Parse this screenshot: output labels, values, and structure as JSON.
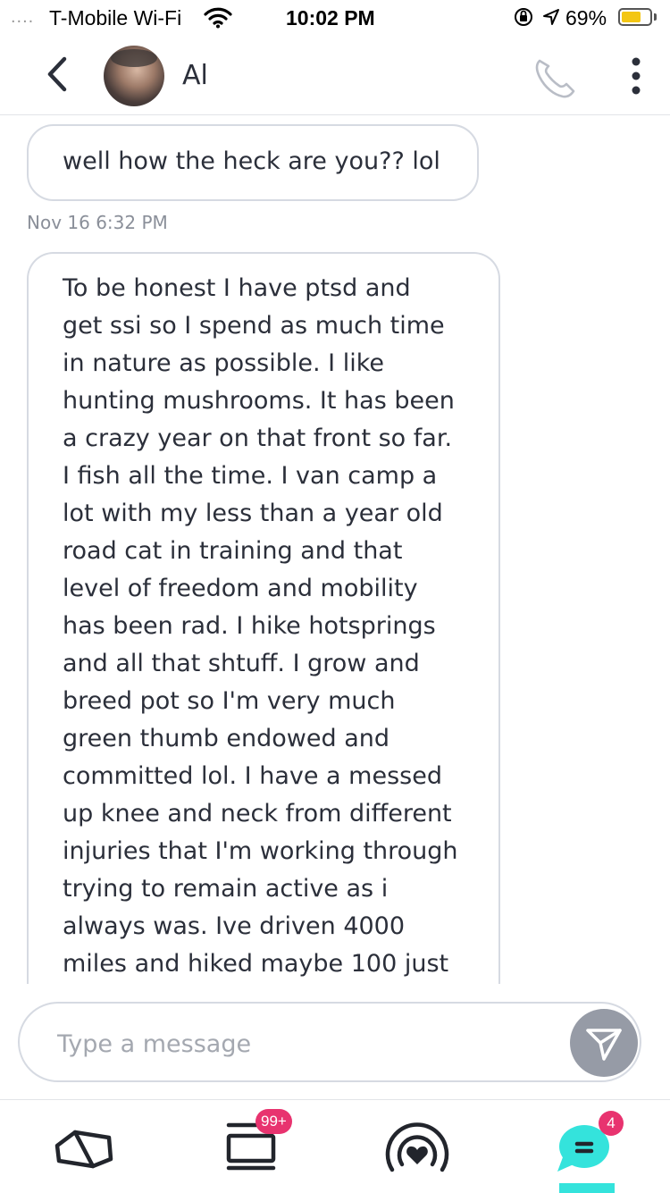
{
  "status_bar": {
    "signal": "....",
    "carrier": "T-Mobile Wi-Fi",
    "time": "10:02 PM",
    "battery_percent": "69%",
    "battery_level": 0.69,
    "battery_color": "#f3c614"
  },
  "header": {
    "contact_name": "Al",
    "back_icon": "chevron-left-icon",
    "call_icon": "phone-icon",
    "more_icon": "vertical-ellipsis-icon"
  },
  "messages": [
    {
      "text": "well how the heck are you?? lol"
    },
    {
      "timestamp": "Nov 16 6:32 PM",
      "lines": [
        "To be honest I have ptsd and",
        "get ssi so I spend as much time",
        "in nature as possible. I like",
        "hunting mushrooms. It has been",
        "a crazy year on that front so far.",
        "I fish all the time. I van camp a",
        "lot with my less than a year old",
        "road cat in training and that",
        "level of freedom and mobility",
        "has been rad. I hike hotsprings",
        "and all that shtuff. I grow and",
        "breed pot so I'm very much",
        "green thumb endowed and",
        "committed lol. I have a messed",
        "up knee and neck from different",
        "injuries that I'm working through",
        "trying to remain active as i",
        "always was. Ive driven 4000",
        "miles and hiked maybe 100 just"
      ]
    }
  ],
  "composer": {
    "placeholder": "Type a message",
    "send_icon": "send-icon"
  },
  "bottom_nav": {
    "items": [
      {
        "icon": "cards-icon"
      },
      {
        "icon": "stack-icon",
        "badge": "99+"
      },
      {
        "icon": "live-heart-icon"
      },
      {
        "icon": "chat-icon",
        "badge": "4",
        "active": true
      }
    ],
    "accent_color": "#34e3dc",
    "badge_color": "#e8336f"
  }
}
